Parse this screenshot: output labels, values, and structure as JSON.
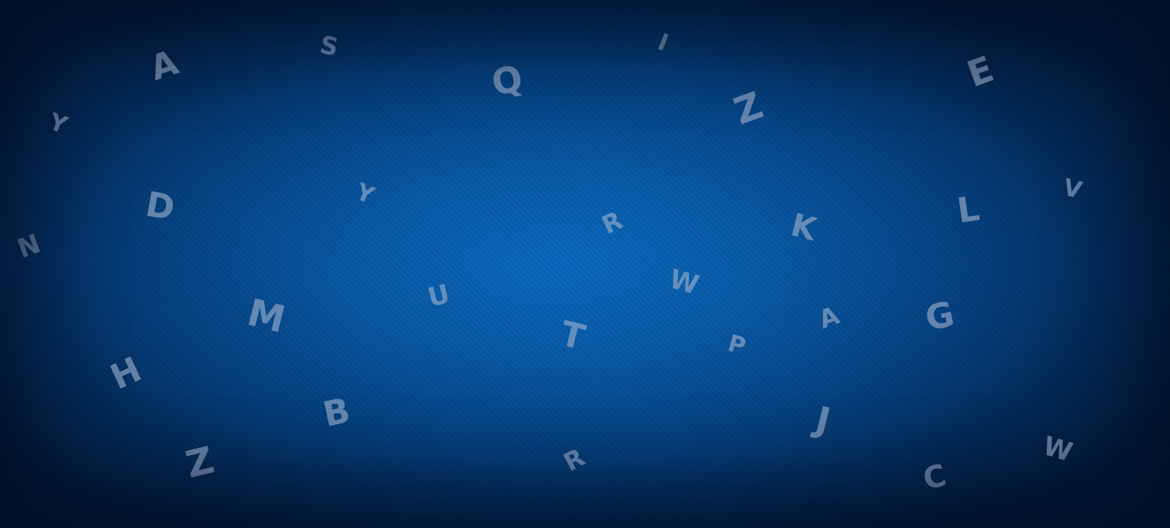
{
  "letters": [
    "A",
    "S",
    "I",
    "Q",
    "Z",
    "E",
    "Y",
    "D",
    "Y",
    "R",
    "K",
    "L",
    "V",
    "N",
    "W",
    "U",
    "M",
    "T",
    "A",
    "G",
    "P",
    "H",
    "B",
    "J",
    "Z",
    "R",
    "C",
    "W"
  ]
}
